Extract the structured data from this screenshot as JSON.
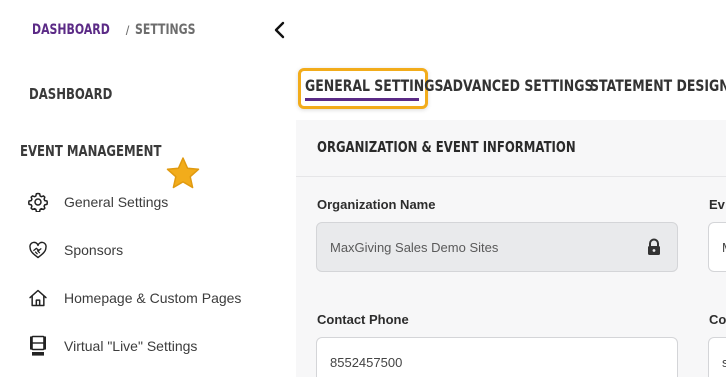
{
  "breadcrumb": {
    "home": "DASHBOARD",
    "separator": "/",
    "current": "SETTINGS"
  },
  "sidebar": {
    "dashboard": "DASHBOARD",
    "section": "EVENT MANAGEMENT",
    "items": [
      {
        "label": "General Settings",
        "icon": "gear-icon"
      },
      {
        "label": "Sponsors",
        "icon": "handshake-heart-icon"
      },
      {
        "label": "Homepage & Custom Pages",
        "icon": "home-icon"
      },
      {
        "label": "Virtual \"Live\" Settings",
        "icon": "film-live-icon"
      }
    ]
  },
  "tabs": [
    {
      "label": "GENERAL SETTINGS",
      "active": true
    },
    {
      "label": "ADVANCED SETTINGS",
      "active": false
    },
    {
      "label": "STATEMENT DESIGN",
      "active": false
    }
  ],
  "section": {
    "title": "ORGANIZATION & EVENT INFORMATION"
  },
  "fields": {
    "org_name": {
      "label": "Organization Name",
      "value": "MaxGiving Sales Demo Sites",
      "locked": true
    },
    "event_label_partial": "Ev",
    "event_value_partial": "M",
    "contact_phone": {
      "label": "Contact Phone",
      "value": "8552457500"
    },
    "contact_partial_label": "Co",
    "contact_partial_value": "s"
  },
  "colors": {
    "brand": "#5b2a86",
    "highlight": "#f2ac1b",
    "star": "#f2ac1b"
  }
}
